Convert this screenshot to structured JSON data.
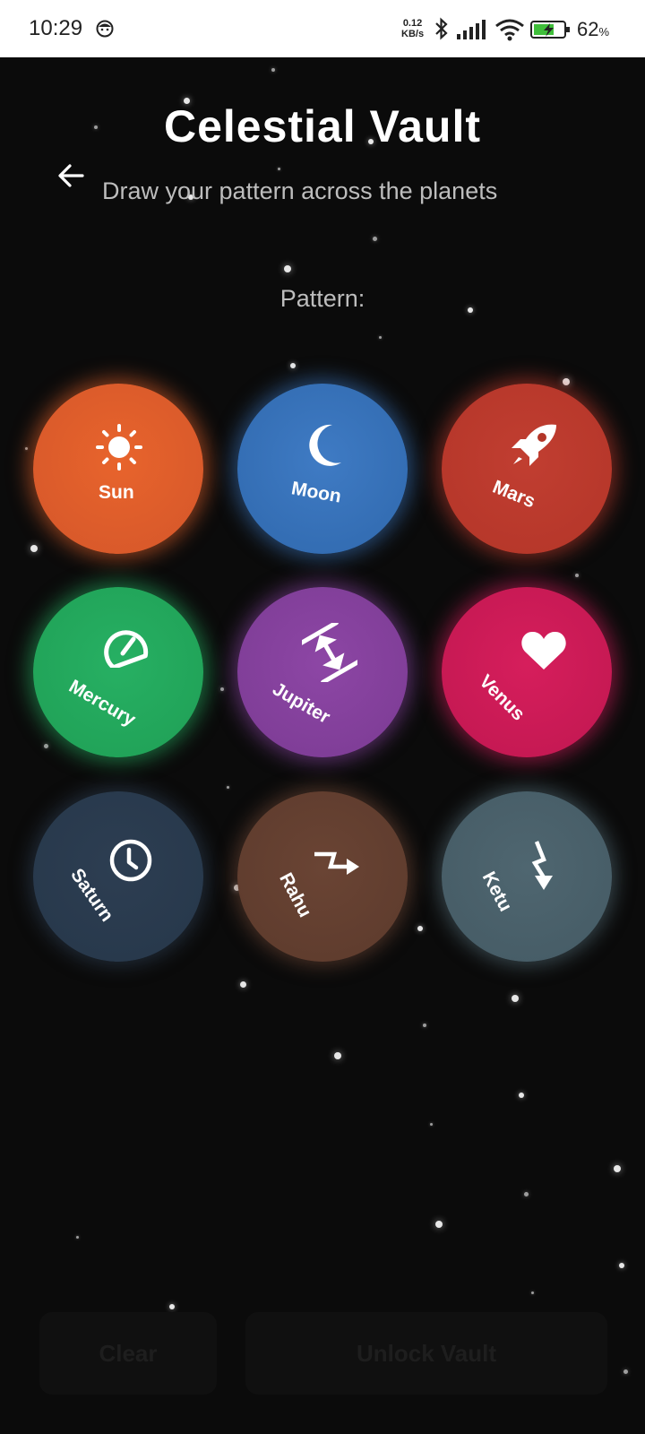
{
  "status_bar": {
    "time": "10:29",
    "net_speed_value": "0.12",
    "net_speed_unit": "KB/s",
    "battery_percent": "62",
    "battery_unit": "%",
    "icons": [
      "face-notification-icon",
      "bluetooth-icon",
      "signal-icon",
      "wifi-icon",
      "battery-charging-icon"
    ]
  },
  "header": {
    "title": "Celestial Vault",
    "subtitle": "Draw your pattern across the planets",
    "back_icon": "arrow-left-icon"
  },
  "pattern_label": "Pattern:",
  "planets": [
    {
      "label": "Sun",
      "icon": "sun-icon",
      "color": "#e1602b"
    },
    {
      "label": "Moon",
      "icon": "crescent-moon-icon",
      "color": "#3a74bd"
    },
    {
      "label": "Mars",
      "icon": "rocket-icon",
      "color": "#bd3a2e"
    },
    {
      "label": "Mercury",
      "icon": "speedometer-icon",
      "color": "#24ad5f"
    },
    {
      "label": "Jupiter",
      "icon": "expand-vertical-icon",
      "color": "#8743a0"
    },
    {
      "label": "Venus",
      "icon": "heart-icon",
      "color": "#d21c58"
    },
    {
      "label": "Saturn",
      "icon": "clock-icon",
      "color": "#2b3c50"
    },
    {
      "label": "Rahu",
      "icon": "zigzag-arrow-right-icon",
      "color": "#654132"
    },
    {
      "label": "Ketu",
      "icon": "zigzag-arrow-down-icon",
      "color": "#4c636d"
    }
  ],
  "buttons": {
    "clear_label": "Clear",
    "unlock_label": "Unlock Vault"
  }
}
